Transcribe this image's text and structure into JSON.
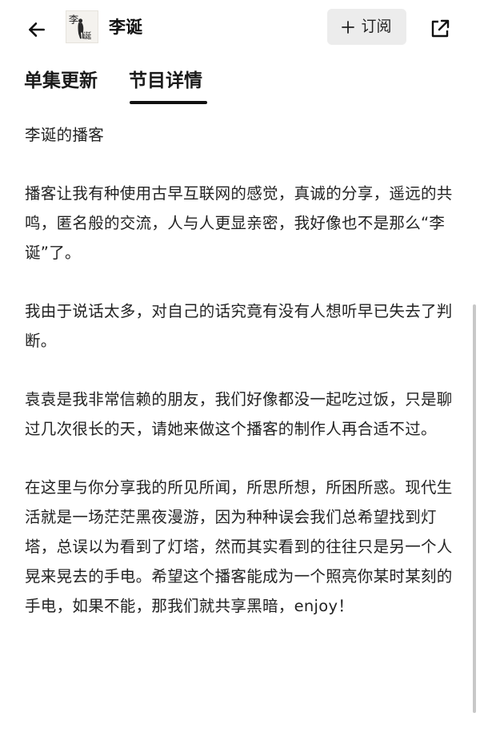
{
  "header": {
    "back_icon": "arrow-left-icon",
    "avatar_text_top": "李",
    "avatar_text_bottom": "诞",
    "title": "李诞",
    "subscribe_label": "订阅",
    "subscribe_icon": "plus-icon",
    "share_icon": "share-external-icon"
  },
  "tabs": [
    {
      "label": "单集更新",
      "active": false
    },
    {
      "label": "节目详情",
      "active": true
    }
  ],
  "content": {
    "paragraphs": [
      "李诞的播客",
      "播客让我有种使用古早互联网的感觉，真诚的分享，遥远的共鸣，匿名般的交流，人与人更显亲密，我好像也不是那么“李诞”了。",
      "我由于说话太多，对自己的话究竟有没有人想听早已失去了判断。",
      "袁袁是我非常信赖的朋友，我们好像都没一起吃过饭，只是聊过几次很长的天，请她来做这个播客的制作人再合适不过。",
      "在这里与你分享我的所见所闻，所思所想，所困所惑。现代生活就是一场茫茫黑夜漫游，因为种种误会我们总希望找到灯塔，总误以为看到了灯塔，然而其实看到的往往只是另一个人晃来晃去的手电。希望这个播客能成为一个照亮你某时某刻的手电，如果不能，那我们就共享黑暗，enjoy！"
    ]
  },
  "colors": {
    "text": "#222222",
    "subscribe_bg": "#ececec",
    "tab_underline": "#111111"
  }
}
